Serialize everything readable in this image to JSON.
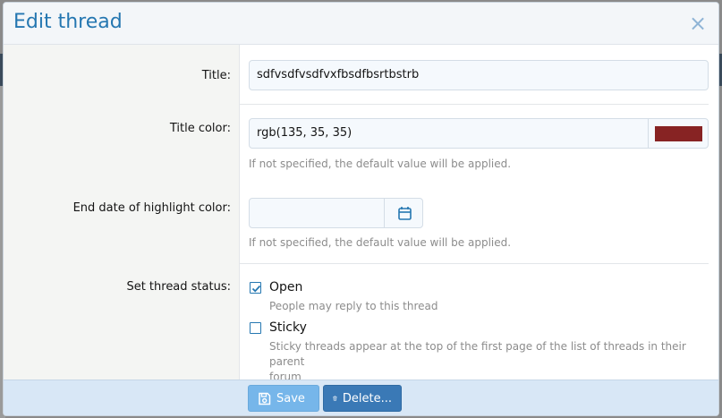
{
  "dialog": {
    "title": "Edit thread",
    "close_glyph": "×"
  },
  "fields": {
    "title": {
      "label": "Title:",
      "value": "sdfvsdfvsdfvxfbsdfbsrtbstrb"
    },
    "title_color": {
      "label": "Title color:",
      "value": "rgb(135, 35, 35)",
      "swatch_color": "#872323",
      "hint": "If not specified, the default value will be applied."
    },
    "highlight_end": {
      "label": "End date of highlight color:",
      "value": "",
      "hint": "If not specified, the default value will be applied."
    },
    "status": {
      "label": "Set thread status:",
      "options": [
        {
          "label": "Open",
          "description": "People may reply to this thread",
          "checked": true
        },
        {
          "label": "Sticky",
          "description_line1": "Sticky threads appear at the top of the first page of the list of threads in their parent",
          "description_line2": "forum",
          "checked": false
        }
      ]
    }
  },
  "footer": {
    "save_label": "Save",
    "delete_label": "Delete..."
  },
  "colors": {
    "accent": "#2577b1",
    "save_button": "#76b6ea",
    "delete_button": "#3a79b6"
  },
  "icons": {
    "close": "close-icon",
    "calendar": "calendar-icon",
    "save": "save-icon",
    "delete": "trash-icon",
    "check": "check-icon"
  }
}
